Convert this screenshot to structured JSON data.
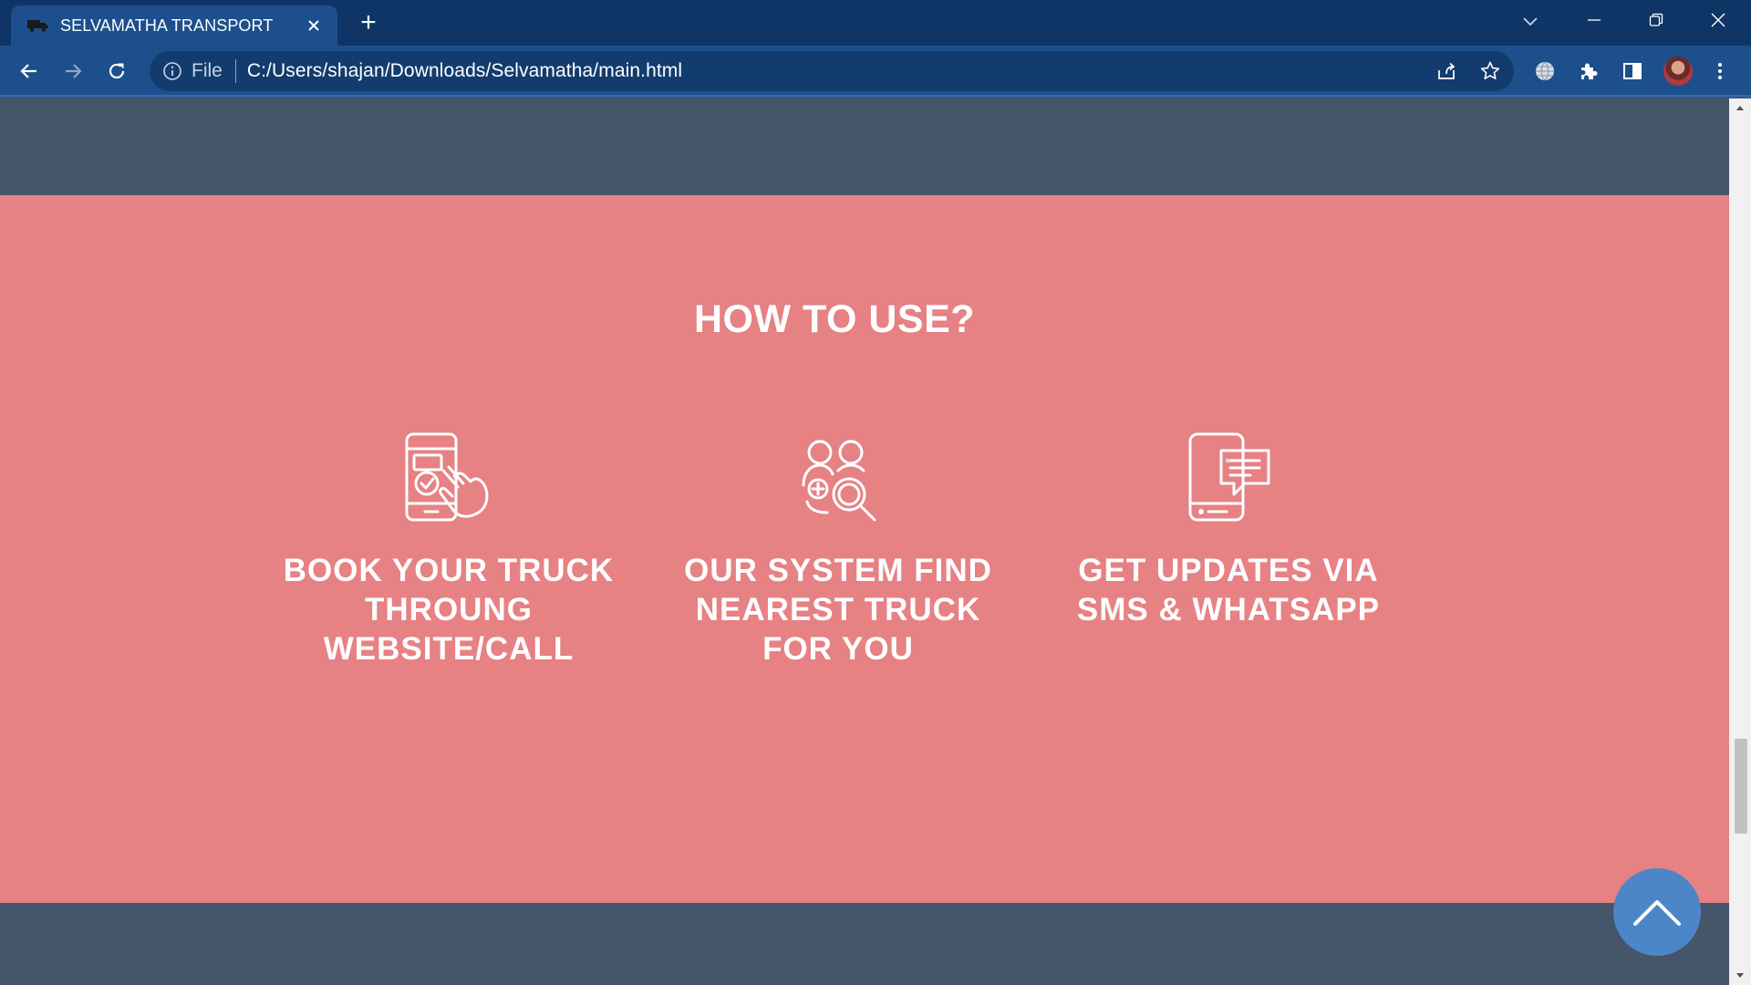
{
  "browser": {
    "tab_title": "SELVAMATHA TRANSPORT",
    "tab_favicon": "truck-icon",
    "new_tab_label": "+",
    "site_info_label": "File",
    "url": "C:/Users/shajan/Downloads/Selvamatha/main.html"
  },
  "page": {
    "section_title": "HOW TO USE?",
    "steps": [
      {
        "icon": "phone-tap-check-icon",
        "label": "BOOK YOUR TRUCK THROUNG WEBSITE/CALL"
      },
      {
        "icon": "people-search-icon",
        "label": "OUR SYSTEM FIND NEAREST TRUCK FOR YOU"
      },
      {
        "icon": "phone-message-icon",
        "label": "GET UPDATES VIA SMS & WHATSAPP"
      }
    ],
    "scroll_top_icon": "chevron-up-icon"
  },
  "colors": {
    "section_bg": "#e68184",
    "band_bg": "#45556a",
    "scroll_top_bg": "#4d86c8",
    "chrome_dark": "#0f3566",
    "chrome_light": "#1c4f8c"
  },
  "scroll_position": 0.72
}
